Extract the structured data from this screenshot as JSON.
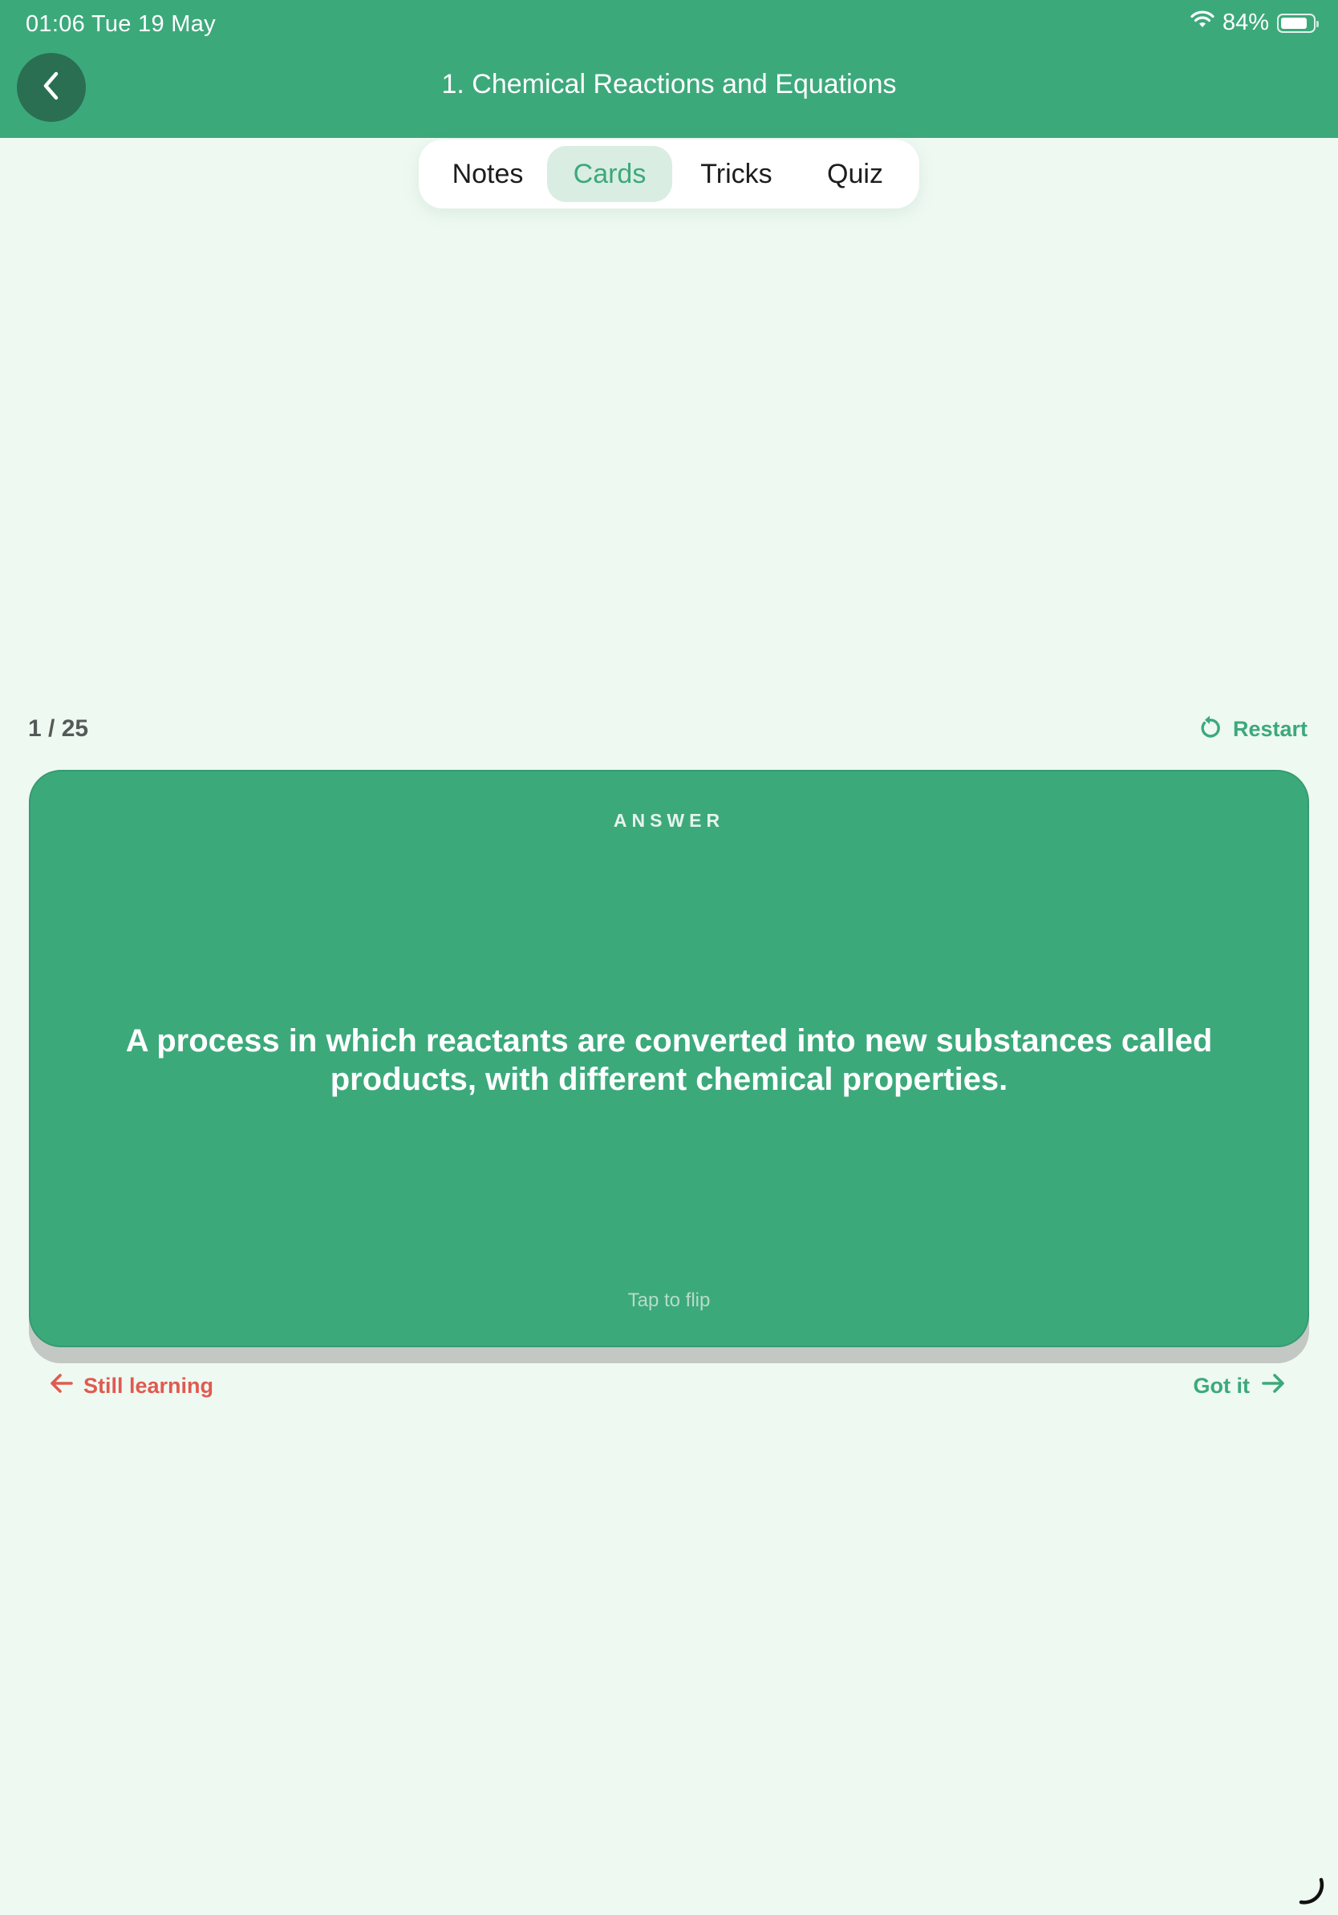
{
  "status_bar": {
    "time_date": "01:06   Tue 19 May",
    "battery_text": "84%",
    "battery_level": 0.84
  },
  "header": {
    "title": "1. Chemical Reactions and Equations"
  },
  "tabs": [
    {
      "label": "Notes",
      "active": false
    },
    {
      "label": "Cards",
      "active": true
    },
    {
      "label": "Tricks",
      "active": false
    },
    {
      "label": "Quiz",
      "active": false
    }
  ],
  "progress": {
    "counter": "1 / 25",
    "restart_label": "Restart"
  },
  "card": {
    "side_label": "ANSWER",
    "text": "A process in which reactants are converted into new substances called products, with different chemical properties.",
    "hint": "Tap to flip"
  },
  "actions": {
    "still_learning_label": "Still learning",
    "got_it_label": "Got it"
  },
  "colors": {
    "brand_green": "#3ca97b",
    "back_button": "#2a6f52",
    "background": "#eef9f2",
    "still_learning_red": "#e05a4f"
  },
  "icons": {
    "back": "chevron-left-icon",
    "wifi": "wifi-icon",
    "battery": "battery-icon",
    "restart": "restart-icon",
    "left_arrow": "arrow-left-icon",
    "right_arrow": "arrow-right-icon"
  }
}
